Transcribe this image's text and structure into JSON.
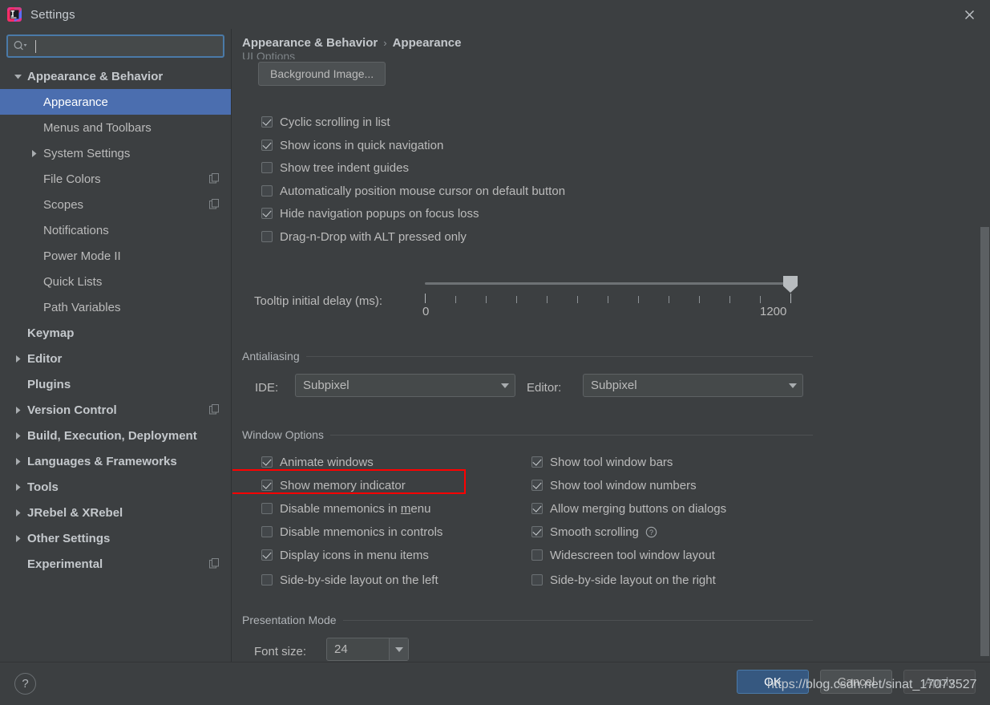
{
  "window": {
    "title": "Settings",
    "app_icon": "intellij-idea-logo-icon",
    "close_icon": "close-icon"
  },
  "search": {
    "value": "",
    "placeholder": "",
    "icon": "search-icon"
  },
  "sidebar": {
    "items": [
      {
        "label": "Appearance & Behavior",
        "level": 0,
        "twisty": "down",
        "selected": false,
        "badge": false
      },
      {
        "label": "Appearance",
        "level": 1,
        "twisty": "none",
        "selected": true,
        "badge": false
      },
      {
        "label": "Menus and Toolbars",
        "level": 1,
        "twisty": "none",
        "selected": false,
        "badge": false
      },
      {
        "label": "System Settings",
        "level": 1,
        "twisty": "right",
        "selected": false,
        "badge": false
      },
      {
        "label": "File Colors",
        "level": 1,
        "twisty": "none",
        "selected": false,
        "badge": true
      },
      {
        "label": "Scopes",
        "level": 1,
        "twisty": "none",
        "selected": false,
        "badge": true
      },
      {
        "label": "Notifications",
        "level": 1,
        "twisty": "none",
        "selected": false,
        "badge": false
      },
      {
        "label": "Power Mode II",
        "level": 1,
        "twisty": "none",
        "selected": false,
        "badge": false
      },
      {
        "label": "Quick Lists",
        "level": 1,
        "twisty": "none",
        "selected": false,
        "badge": false
      },
      {
        "label": "Path Variables",
        "level": 1,
        "twisty": "none",
        "selected": false,
        "badge": false
      },
      {
        "label": "Keymap",
        "level": 0,
        "twisty": "none",
        "selected": false,
        "badge": false
      },
      {
        "label": "Editor",
        "level": 0,
        "twisty": "right",
        "selected": false,
        "badge": false
      },
      {
        "label": "Plugins",
        "level": 0,
        "twisty": "none",
        "selected": false,
        "badge": false
      },
      {
        "label": "Version Control",
        "level": 0,
        "twisty": "right",
        "selected": false,
        "badge": true
      },
      {
        "label": "Build, Execution, Deployment",
        "level": 0,
        "twisty": "right",
        "selected": false,
        "badge": false
      },
      {
        "label": "Languages & Frameworks",
        "level": 0,
        "twisty": "right",
        "selected": false,
        "badge": false
      },
      {
        "label": "Tools",
        "level": 0,
        "twisty": "right",
        "selected": false,
        "badge": false
      },
      {
        "label": "JRebel & XRebel",
        "level": 0,
        "twisty": "right",
        "selected": false,
        "badge": false
      },
      {
        "label": "Other Settings",
        "level": 0,
        "twisty": "right",
        "selected": false,
        "badge": false
      },
      {
        "label": "Experimental",
        "level": 0,
        "twisty": "none",
        "selected": false,
        "badge": true
      }
    ]
  },
  "breadcrumb": {
    "root": "Appearance & Behavior",
    "separator": "›",
    "leaf": "Appearance"
  },
  "main": {
    "clipped_group_label": "UI Options",
    "background_image_button": "Background Image...",
    "ui_options_checkboxes": [
      {
        "label": "Cyclic scrolling in list",
        "checked": true
      },
      {
        "label": "Show icons in quick navigation",
        "checked": true
      },
      {
        "label": "Show tree indent guides",
        "checked": false
      },
      {
        "label": "Automatically position mouse cursor on default button",
        "checked": false
      },
      {
        "label": "Hide navigation popups on focus loss",
        "checked": true
      },
      {
        "label": "Drag-n-Drop with ALT pressed only",
        "checked": false
      }
    ],
    "tooltip_slider": {
      "label": "Tooltip initial delay (ms):",
      "min_label": "0",
      "max_label": "1200",
      "min": 0,
      "max": 1200,
      "value": 1200,
      "tick_count": 13
    },
    "antialiasing": {
      "group_label": "Antialiasing",
      "ide_label": "IDE:",
      "ide_value": "Subpixel",
      "editor_label": "Editor:",
      "editor_value": "Subpixel"
    },
    "window_options": {
      "group_label": "Window Options",
      "left_column": [
        {
          "label": "Animate windows",
          "checked": true,
          "mnemonic": ""
        },
        {
          "label": "Show memory indicator",
          "checked": true,
          "mnemonic": "",
          "highlighted": true
        },
        {
          "label": "Disable mnemonics in menu",
          "checked": false,
          "mnemonic": "m"
        },
        {
          "label": "Disable mnemonics in controls",
          "checked": false,
          "mnemonic": ""
        },
        {
          "label": "Display icons in menu items",
          "checked": true,
          "mnemonic": ""
        },
        {
          "label": "Side-by-side layout on the left",
          "checked": false,
          "mnemonic": ""
        }
      ],
      "right_column": [
        {
          "label": "Show tool window bars",
          "checked": true,
          "help": false
        },
        {
          "label": "Show tool window numbers",
          "checked": true,
          "help": false
        },
        {
          "label": "Allow merging buttons on dialogs",
          "checked": true,
          "help": false
        },
        {
          "label": "Smooth scrolling",
          "checked": true,
          "help": true
        },
        {
          "label": "Widescreen tool window layout",
          "checked": false,
          "help": false
        },
        {
          "label": "Side-by-side layout on the right",
          "checked": false,
          "help": false
        }
      ]
    },
    "presentation_mode": {
      "group_label": "Presentation Mode",
      "font_size_label": "Font size:",
      "font_size_value": "24"
    }
  },
  "footer": {
    "help_label": "?",
    "ok_label": "OK",
    "cancel_label": "Cancel",
    "apply_label": "Apply"
  },
  "watermark": {
    "text": "https://blog.csdn.net/sinat_17073527"
  },
  "colors": {
    "window_bg": "#3c3f41",
    "selection_blue": "#4b6eaf",
    "ok_button_blue": "#365880",
    "highlight_red": "#ff0000",
    "text": "#bbbbbb",
    "field_bg": "#45494a"
  }
}
